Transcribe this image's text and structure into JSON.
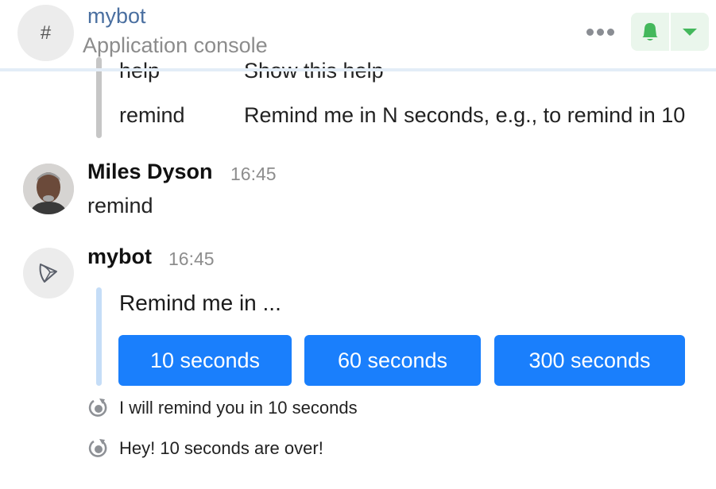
{
  "header": {
    "room_icon": "hash-icon",
    "room_icon_glyph": "#",
    "room_name": "mybot",
    "room_topic": "Application console",
    "more_icon": "more-options-icon",
    "notification_icon": "bell-icon",
    "notification_dropdown_icon": "chevron-down-icon"
  },
  "timeline": {
    "help_table": {
      "rows": [
        {
          "command": "help",
          "description": "Show this help"
        },
        {
          "command": "remind",
          "description": "Remind me in N seconds, e.g., to remind in 10"
        }
      ]
    },
    "messages": [
      {
        "sender": "Miles Dyson",
        "time": "16:45",
        "avatar": "user-photo-avatar",
        "body": "remind"
      },
      {
        "sender": "mybot",
        "time": "16:45",
        "avatar": "bot-icon",
        "prompt": "Remind me in ...",
        "buttons": [
          "10 seconds",
          "60 seconds",
          "300 seconds"
        ]
      }
    ],
    "notices": [
      {
        "icon": "reminder-icon",
        "text": "I will remind you in 10 seconds"
      },
      {
        "icon": "reminder-icon",
        "text": "Hey! 10 seconds are over!"
      }
    ]
  },
  "colors": {
    "accent_blue": "#1a7ffc",
    "room_name": "#4a6fa0",
    "notification_green": "#44b85c",
    "notification_bg": "#eaf6ec",
    "quote_bar_blue": "#c5ddf7"
  }
}
